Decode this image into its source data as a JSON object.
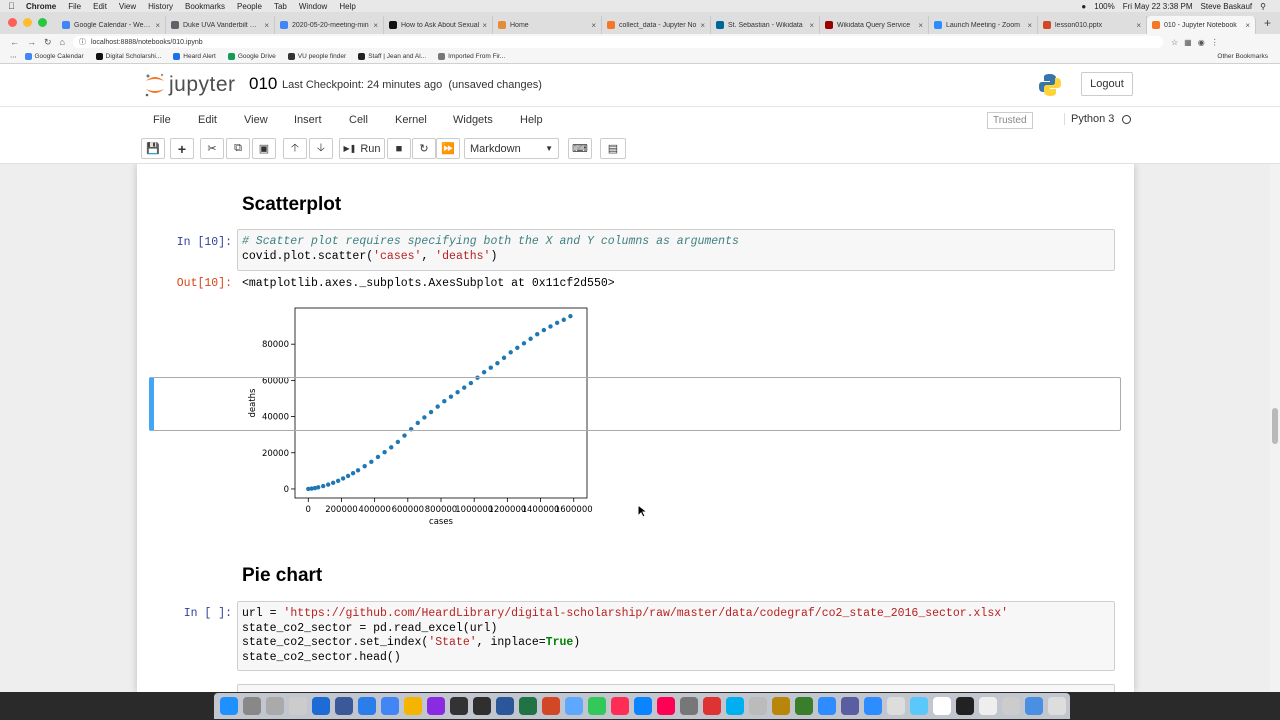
{
  "mac_menubar": {
    "app": "Chrome",
    "items": [
      "File",
      "Edit",
      "View",
      "History",
      "Bookmarks",
      "People",
      "Tab",
      "Window",
      "Help"
    ],
    "battery": "100%",
    "datetime": "Fri May 22  3:38 PM",
    "user": "Steve Baskauf"
  },
  "browser": {
    "tabs": [
      {
        "label": "Google Calendar - Week o",
        "color": "#4285f4"
      },
      {
        "label": "Duke UVA Vanderbilt Climb",
        "color": "#5f6368"
      },
      {
        "label": "2020-05-20-meeting-min",
        "color": "#4285f4"
      },
      {
        "label": "How to Ask About Sexual",
        "color": "#111111"
      },
      {
        "label": "Home",
        "color": "#e58c3a"
      },
      {
        "label": "collect_data - Jupyter No",
        "color": "#f37726"
      },
      {
        "label": "St. Sebastian - Wikidata",
        "color": "#006699"
      },
      {
        "label": "Wikidata Query Service",
        "color": "#990000"
      },
      {
        "label": "Launch Meeting - Zoom",
        "color": "#2d8cff"
      },
      {
        "label": "lesson010.pptx",
        "color": "#d24726"
      },
      {
        "label": "010 - Jupyter Notebook",
        "color": "#f37726"
      }
    ],
    "new_tab": "+",
    "url": "localhost:8888/notebooks/010.ipynb",
    "bookmarks": [
      "Google Calendar",
      "Digital Scholarshi...",
      "Heard Alert",
      "Google Drive",
      "VU people finder",
      "Staff | Jean and Al...",
      "Imported From Fir..."
    ],
    "other_bookmarks": "Other Bookmarks"
  },
  "jupyter": {
    "logo_text": "jupyter",
    "notebook_name": "010",
    "checkpoint": "Last Checkpoint: 24 minutes ago",
    "unsaved": "(unsaved changes)",
    "logout": "Logout",
    "menu": [
      "File",
      "Edit",
      "View",
      "Insert",
      "Cell",
      "Kernel",
      "Widgets",
      "Help"
    ],
    "trusted": "Trusted",
    "kernel": "Python 3",
    "toolbar": {
      "run_label": "Run",
      "cell_type": "Markdown"
    }
  },
  "cells": {
    "scatter_heading": "Scatterplot",
    "in10_prompt": "In [10]:",
    "in10_line1": "# Scatter plot requires specifying both the X and Y columns as arguments",
    "in10_line2_code": "covid.plot.scatter(",
    "in10_line2_s1": "'cases'",
    "in10_line2_comma": ", ",
    "in10_line2_s2": "'deaths'",
    "in10_line2_end": ")",
    "out10_prompt": "Out[10]:",
    "out10_text": "<matplotlib.axes._subplots.AxesSubplot at 0x11cf2d550>",
    "pie_heading": "Pie chart",
    "in_blank_prompt": "In [ ]:",
    "pie_l1_a": "url = ",
    "pie_l1_s": "'https://github.com/HeardLibrary/digital-scholarship/raw/master/data/codegraf/co2_state_2016_sector.xlsx'",
    "pie_l2": "state_co2_sector = pd.read_excel(url)",
    "pie_l3_a": "state_co2_sector.set_index(",
    "pie_l3_s": "'State'",
    "pie_l3_b": ", inplace=",
    "pie_l3_kw": "True",
    "pie_l3_c": ")",
    "pie_l4": "state_co2_sector.head()"
  },
  "chart_data": {
    "type": "scatter",
    "xlabel": "cases",
    "ylabel": "deaths",
    "xlim": [
      -80000,
      1680000
    ],
    "ylim": [
      -5000,
      100000
    ],
    "xticks": [
      0,
      200000,
      400000,
      600000,
      800000,
      1000000,
      1200000,
      1400000,
      1600000
    ],
    "yticks": [
      0,
      20000,
      40000,
      60000,
      80000
    ],
    "color": "#1f77b4",
    "x": [
      0,
      20000,
      40000,
      60000,
      90000,
      120000,
      150000,
      180000,
      210000,
      240000,
      270000,
      300000,
      340000,
      380000,
      420000,
      460000,
      500000,
      540000,
      580000,
      620000,
      660000,
      700000,
      740000,
      780000,
      820000,
      860000,
      900000,
      940000,
      980000,
      1020000,
      1060000,
      1100000,
      1140000,
      1180000,
      1220000,
      1260000,
      1300000,
      1340000,
      1380000,
      1420000,
      1460000,
      1500000,
      1540000,
      1580000
    ],
    "y": [
      0,
      200,
      500,
      900,
      1600,
      2400,
      3400,
      4500,
      5800,
      7200,
      8700,
      10300,
      12600,
      15000,
      17700,
      20300,
      23000,
      26000,
      29500,
      33000,
      36500,
      39500,
      42500,
      45500,
      48500,
      51000,
      53500,
      56000,
      58500,
      61500,
      64500,
      67000,
      69500,
      72500,
      75500,
      78000,
      80500,
      83000,
      85500,
      87800,
      89800,
      91800,
      93500,
      95500
    ]
  }
}
